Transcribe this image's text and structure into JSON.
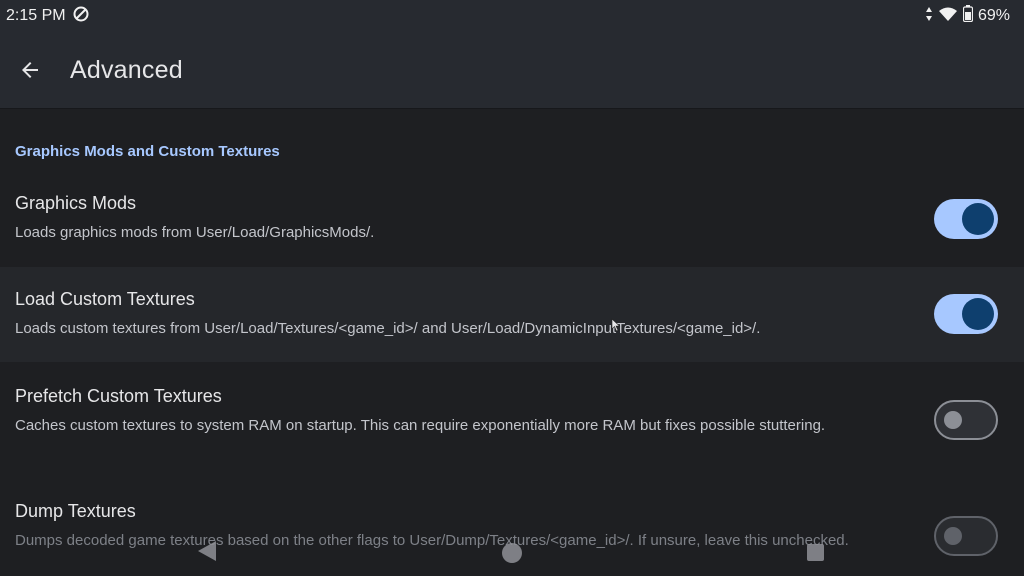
{
  "status_bar": {
    "time": "2:15 PM",
    "battery": "69%"
  },
  "app_bar": {
    "title": "Advanced"
  },
  "section": {
    "header": "Graphics Mods and Custom Textures"
  },
  "settings": [
    {
      "title": "Graphics Mods",
      "description": "Loads graphics mods from User/Load/GraphicsMods/.",
      "enabled": true
    },
    {
      "title": "Load Custom Textures",
      "description": "Loads custom textures from User/Load/Textures/<game_id>/ and User/Load/DynamicInputTextures/<game_id>/.",
      "enabled": true
    },
    {
      "title": "Prefetch Custom Textures",
      "description": "Caches custom textures to system RAM on startup. This can require exponentially more RAM but fixes possible stuttering.",
      "enabled": false
    },
    {
      "title": "Dump Textures",
      "description": "Dumps decoded game textures based on the other flags to User/Dump/Textures/<game_id>/. If unsure, leave this unchecked.",
      "enabled": false
    }
  ],
  "icons": {
    "status_left": "sync-disabled-icon",
    "status_right": [
      "data-arrows-icon",
      "wifi-icon",
      "battery-icon"
    ],
    "navigation": [
      "nav-back-icon",
      "nav-home-icon",
      "nav-recents-icon"
    ]
  },
  "colors": {
    "accent": "#a7c8ff",
    "toggle_knob_on": "#0e3f6e",
    "background": "#1e1f22",
    "app_bar": "#272a30"
  }
}
